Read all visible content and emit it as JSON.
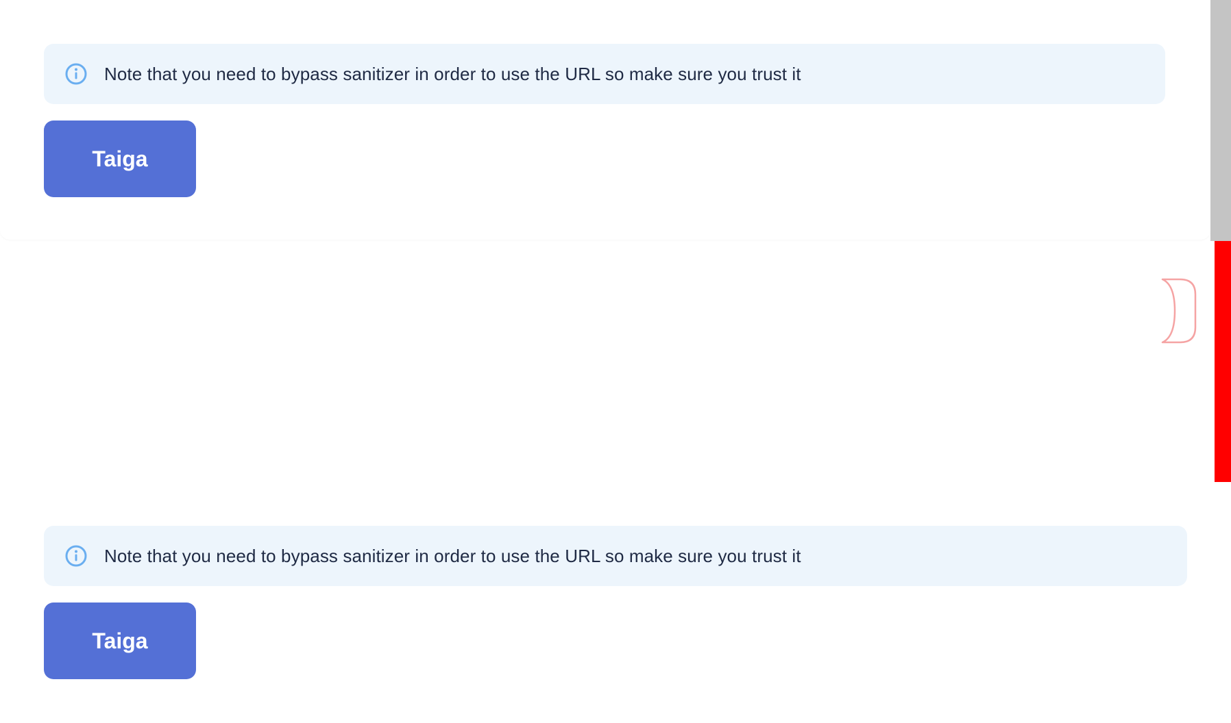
{
  "colors": {
    "banner_background": "#edf5fc",
    "banner_text": "#1f2a44",
    "info_icon": "#6aaef0",
    "button_background": "#5470d6",
    "button_text": "#ffffff",
    "scrollbar": "#c4c4c4",
    "red_strip": "#ff0000"
  },
  "sections": [
    {
      "banner": {
        "icon": "info-icon",
        "text": "Note that you need to bypass sanitizer in order to use the URL so make sure you trust it"
      },
      "button": {
        "label": "Taiga"
      }
    },
    {
      "banner": {
        "icon": "info-icon",
        "text": "Note that you need to bypass sanitizer in order to use the URL so make sure you trust it"
      },
      "button": {
        "label": "Taiga"
      }
    }
  ]
}
